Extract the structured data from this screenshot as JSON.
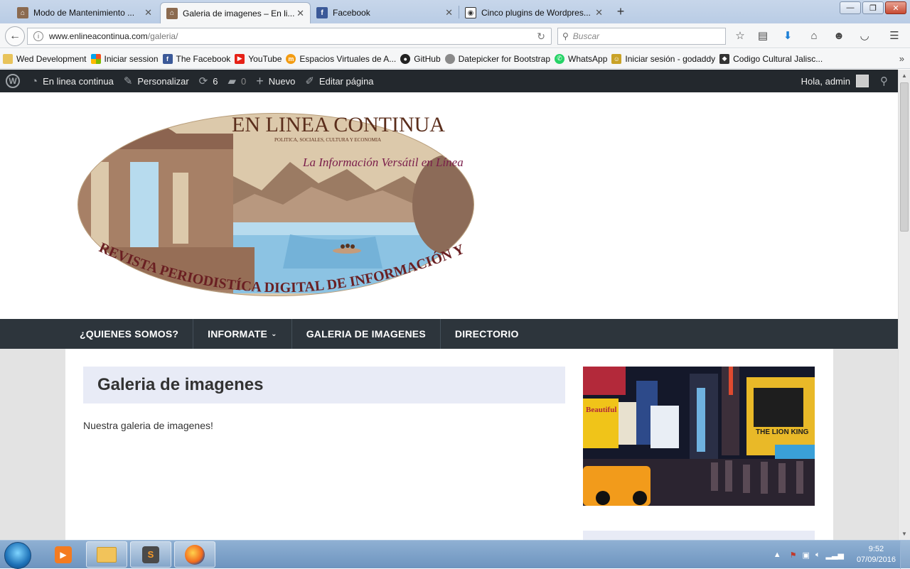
{
  "browser": {
    "tabs": [
      {
        "title": "Modo de Mantenimiento ...",
        "active": false
      },
      {
        "title": "Galeria de imagenes – En li...",
        "active": true
      },
      {
        "title": "Facebook",
        "active": false
      },
      {
        "title": "Cinco plugins de Wordpres...",
        "active": false
      }
    ],
    "new_tab": "+",
    "url_host": "www.enlineacontinua.com",
    "url_path": "/galeria/",
    "search_placeholder": "Buscar",
    "bookmarks": [
      "Wed Development",
      "Iniciar session",
      "The Facebook",
      "YouTube",
      "Espacios Virtuales de A...",
      "GitHub",
      "Datepicker for Bootstrap",
      "WhatsApp",
      "Iniciar sesión - godaddy",
      "Codigo Cultural Jalisc..."
    ],
    "bookmarks_overflow": "»"
  },
  "wp_admin_bar": {
    "site_name": "En linea continua",
    "customize": "Personalizar",
    "updates_count": "6",
    "comments_count": "0",
    "new_label": "Nuevo",
    "edit_label": "Editar página",
    "greeting": "Hola, admin"
  },
  "site": {
    "logo_title": "EN LINEA CONTINUA",
    "logo_subtitle": "POLITICA, SOCIALES, CULTURA Y ECONOMIA",
    "logo_tagline": "La Información Versátil en Línea",
    "logo_banner": "REVISTA PERIODISTÍCA DIGITAL DE INFORMACIÓN Y ÁNALISIS CONTINUA",
    "menu": [
      {
        "label": "¿QUIENES SOMOS?",
        "dropdown": false
      },
      {
        "label": "INFORMATE",
        "dropdown": true
      },
      {
        "label": "GALERIA DE IMAGENES",
        "dropdown": false
      },
      {
        "label": "DIRECTORIO",
        "dropdown": false
      }
    ],
    "page_title": "Galeria de imagenes",
    "page_text": "Nuestra galeria de imagenes!",
    "sidebar_image_signs": {
      "sign1": "Beautiful",
      "sign2": "THE LION KING"
    }
  },
  "taskbar": {
    "time": "9:52",
    "date": "07/09/2016"
  }
}
